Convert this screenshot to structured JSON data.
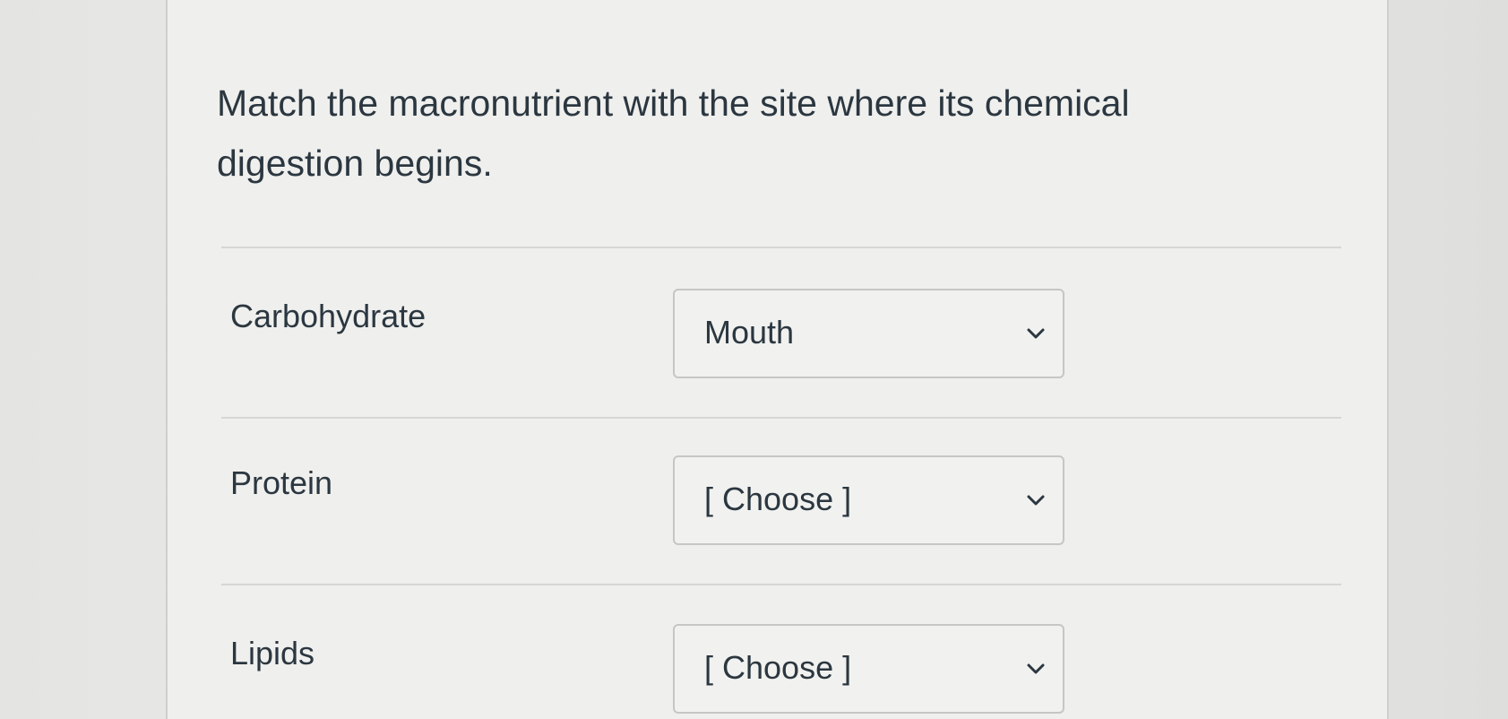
{
  "question": {
    "line1": "Match the macronutrient with the site where its chemical",
    "line2": "digestion begins."
  },
  "rows": [
    {
      "label": "Carbohydrate",
      "selected": "Mouth"
    },
    {
      "label": "Protein",
      "selected": "[ Choose ]"
    },
    {
      "label": "Lipids",
      "selected": "[ Choose ]"
    }
  ],
  "icons": {
    "dropdown": "chevron-down-icon"
  },
  "colors": {
    "text": "#2b3740",
    "border": "#c6c6c4",
    "divider": "#d6d6d4"
  }
}
